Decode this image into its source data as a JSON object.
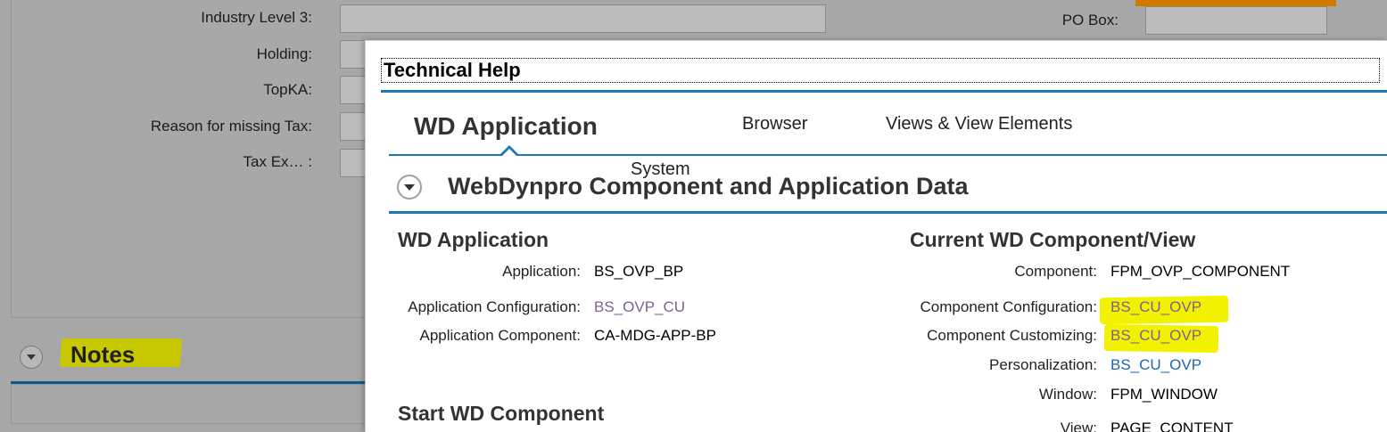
{
  "background": {
    "fields": [
      {
        "label": "Industry Level 3:"
      },
      {
        "label": "Holding:"
      },
      {
        "label": "TopKA:"
      },
      {
        "label": "Reason for missing Tax:"
      },
      {
        "label": "Tax Ex… :"
      }
    ],
    "po_box_label": "PO Box:",
    "notes_title": "Notes"
  },
  "popup": {
    "title": "Technical Help",
    "tabs": [
      {
        "label": "WD Application",
        "active": true
      },
      {
        "label": "System"
      },
      {
        "label": "Browser"
      },
      {
        "label": "Views & View Elements"
      }
    ],
    "section_title": "WebDynpro Component and Application Data",
    "left": {
      "title": "WD Application",
      "rows": [
        {
          "label": "Application:",
          "value": "BS_OVP_BP"
        },
        {
          "label": "Application Configuration:",
          "value": "BS_OVP_CU"
        },
        {
          "label": "Application Component:",
          "value": "CA-MDG-APP-BP"
        }
      ],
      "start_title": "Start WD Component"
    },
    "right": {
      "title": "Current WD Component/View",
      "rows": [
        {
          "label": "Component:",
          "value": "FPM_OVP_COMPONENT"
        },
        {
          "label": "Component Configuration:",
          "value": "BS_CU_OVP"
        },
        {
          "label": "Component Customizing:",
          "value": "BS_CU_OVP"
        },
        {
          "label": "Personalization:",
          "value": "BS_CU_OVP"
        },
        {
          "label": "Window:",
          "value": "FPM_WINDOW"
        },
        {
          "label": "View:",
          "value": "PAGE_CONTENT"
        }
      ]
    }
  },
  "colors": {
    "accent": "#1f78b4",
    "highlight": "#f2f200",
    "link_purple": "#7b6290",
    "link_blue": "#1b67b3"
  }
}
